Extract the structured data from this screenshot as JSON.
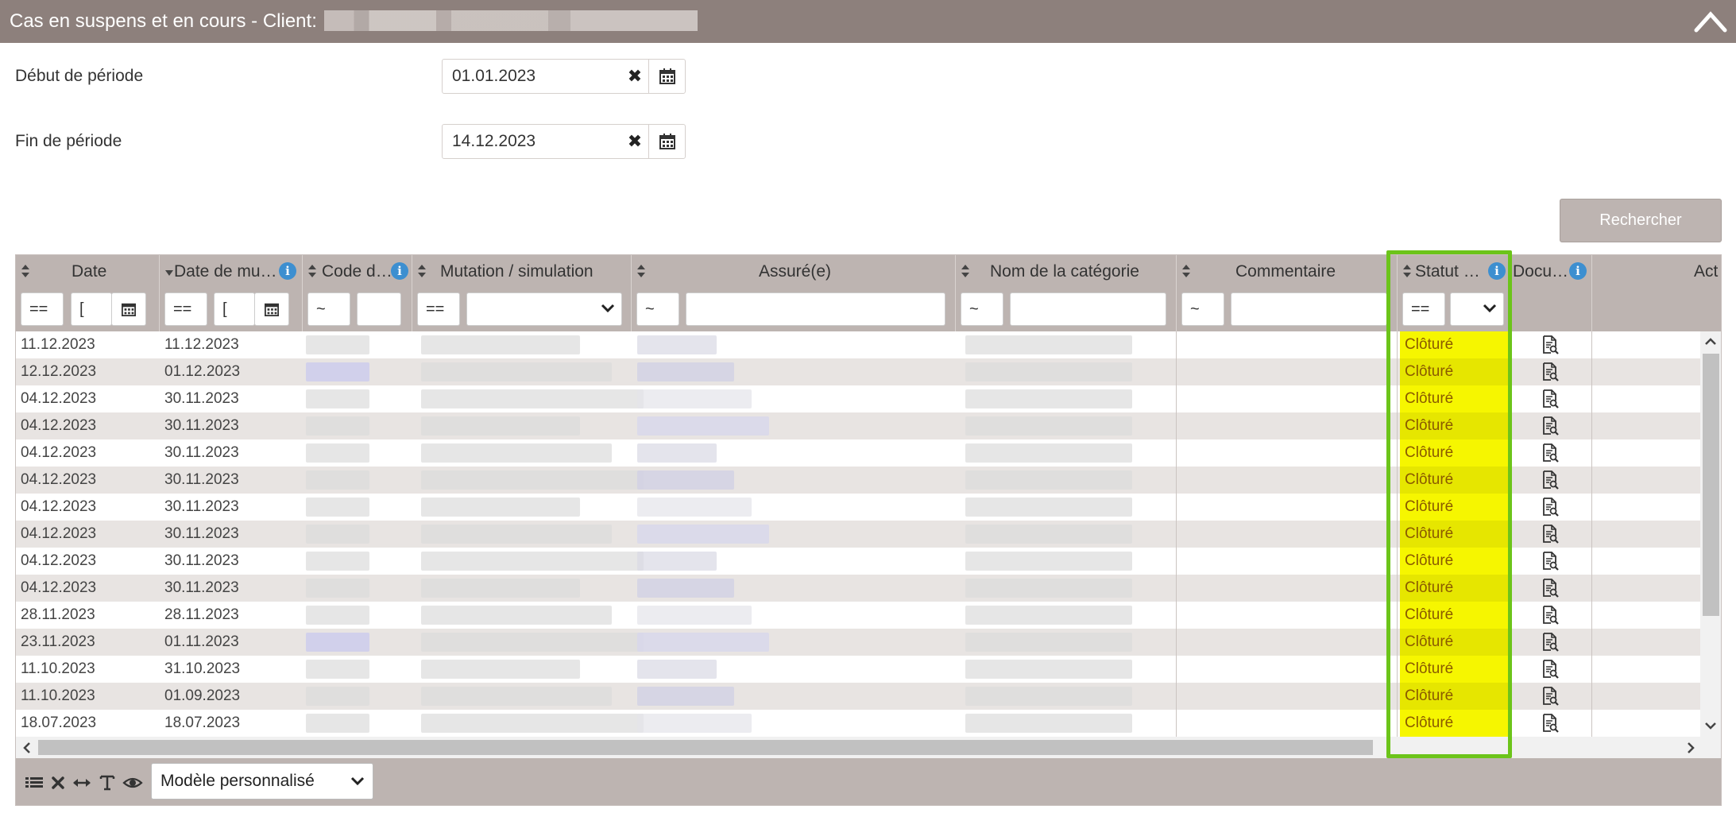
{
  "header": {
    "title": "Cas en suspens et en cours - Client:"
  },
  "period": {
    "start_label": "Début de période",
    "start_value": "01.01.2023",
    "end_label": "Fin de période",
    "end_value": "14.12.2023"
  },
  "search_button": "Rechercher",
  "columns": [
    {
      "label": "Date",
      "info": false
    },
    {
      "label": "Date de mu…",
      "info": true,
      "sorted": "desc"
    },
    {
      "label": "Code d…",
      "info": true
    },
    {
      "label": "Mutation / simulation",
      "info": false
    },
    {
      "label": "Assuré(e)",
      "info": false
    },
    {
      "label": "Nom de la catégorie",
      "info": false
    },
    {
      "label": "Commentaire",
      "info": false
    },
    {
      "label": "Statut …",
      "info": true
    },
    {
      "label": "Docu…",
      "info": true
    },
    {
      "label": "Act",
      "info": false
    }
  ],
  "filters": {
    "date_op": "==",
    "date_value": "[",
    "mutation_date_op": "==",
    "mutation_date_value": "[",
    "code_op": "~",
    "mutation_op": "==",
    "insured_op": "~",
    "category_op": "~",
    "comment_op": "~",
    "status_op": "=="
  },
  "rows": [
    {
      "date": "11.12.2023",
      "mutation_date": "11.12.2023",
      "status": "Clôturé"
    },
    {
      "date": "12.12.2023",
      "mutation_date": "01.12.2023",
      "status": "Clôturé"
    },
    {
      "date": "04.12.2023",
      "mutation_date": "30.11.2023",
      "status": "Clôturé"
    },
    {
      "date": "04.12.2023",
      "mutation_date": "30.11.2023",
      "status": "Clôturé"
    },
    {
      "date": "04.12.2023",
      "mutation_date": "30.11.2023",
      "status": "Clôturé"
    },
    {
      "date": "04.12.2023",
      "mutation_date": "30.11.2023",
      "status": "Clôturé"
    },
    {
      "date": "04.12.2023",
      "mutation_date": "30.11.2023",
      "status": "Clôturé"
    },
    {
      "date": "04.12.2023",
      "mutation_date": "30.11.2023",
      "status": "Clôturé"
    },
    {
      "date": "04.12.2023",
      "mutation_date": "30.11.2023",
      "status": "Clôturé"
    },
    {
      "date": "04.12.2023",
      "mutation_date": "30.11.2023",
      "status": "Clôturé"
    },
    {
      "date": "28.11.2023",
      "mutation_date": "28.11.2023",
      "status": "Clôturé"
    },
    {
      "date": "23.11.2023",
      "mutation_date": "01.11.2023",
      "status": "Clôturé"
    },
    {
      "date": "11.10.2023",
      "mutation_date": "31.10.2023",
      "status": "Clôturé"
    },
    {
      "date": "11.10.2023",
      "mutation_date": "01.09.2023",
      "status": "Clôturé"
    },
    {
      "date": "18.07.2023",
      "mutation_date": "18.07.2023",
      "status": "Clôturé"
    }
  ],
  "footer": {
    "template_label": "Modèle personnalisé"
  },
  "colors": {
    "header_bg": "#8d807c",
    "grid_header_bg": "#bdb4b1",
    "status_highlight": "#f6f600",
    "focus_border": "#6cc41a"
  },
  "icons": [
    "chevron-up-icon",
    "clear-icon",
    "calendar-icon",
    "sort-icon",
    "info-icon",
    "document-view-icon",
    "list-icon",
    "close-icon",
    "resize-columns-icon",
    "text-icon",
    "eye-icon",
    "chevron-down-icon"
  ]
}
